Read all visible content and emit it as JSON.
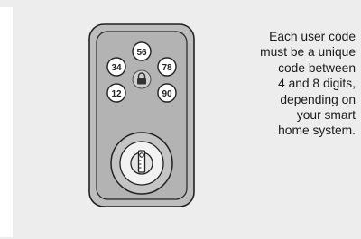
{
  "keypad": {
    "buttons": [
      "56",
      "34",
      "78",
      "12",
      "90"
    ],
    "center_icon": "padlock-icon"
  },
  "deadbolt": {
    "icon": "key-cylinder-icon"
  },
  "caption": {
    "lines": [
      "Each user code",
      "must be a unique",
      "code between",
      "4 and 8 digits,",
      "depending on",
      "your smart",
      "home system."
    ]
  }
}
